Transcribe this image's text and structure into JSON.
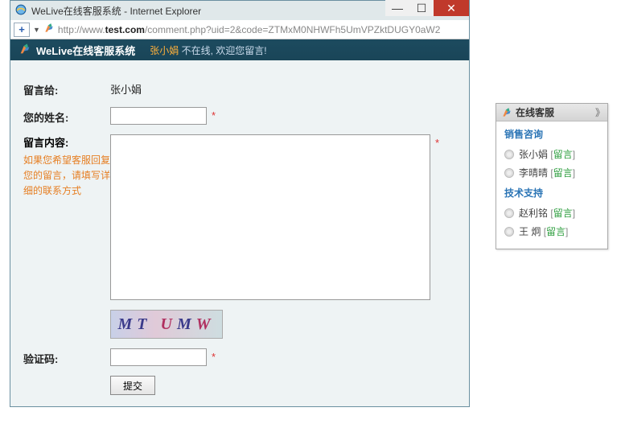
{
  "window": {
    "title": "WeLive在线客服系统 - Internet Explorer",
    "url_host": "test.com",
    "url_prefix": "http://www.",
    "url_path": "/comment.php?uid=2&code=ZTMxM0NHWFh5UmVPZktDUGY0aW2"
  },
  "header": {
    "title": "WeLive在线客服系统",
    "name": "张小娟",
    "status_rest": " 不在线, 欢迎您留言!"
  },
  "form": {
    "recipient_label": "留言给:",
    "recipient_name": "张小娟",
    "name_label": "您的姓名:",
    "content_label": "留言内容:",
    "content_hint": "如果您希望客服回复您的留言，请填写详细的联系方式",
    "captcha_label": "验证码:",
    "captcha_text": "MTUMW",
    "submit_label": "提交",
    "required_mark": "*"
  },
  "side": {
    "title": "在线客服",
    "collapse": "》",
    "groups": [
      {
        "title": "销售咨询",
        "items": [
          {
            "name": "张小娟",
            "action": "留言"
          },
          {
            "name": "李晴晴",
            "action": "留言"
          }
        ]
      },
      {
        "title": "技术支持",
        "items": [
          {
            "name": "赵利铭",
            "action": "留言"
          },
          {
            "name": "王 炯",
            "action": "留言"
          }
        ]
      }
    ]
  }
}
